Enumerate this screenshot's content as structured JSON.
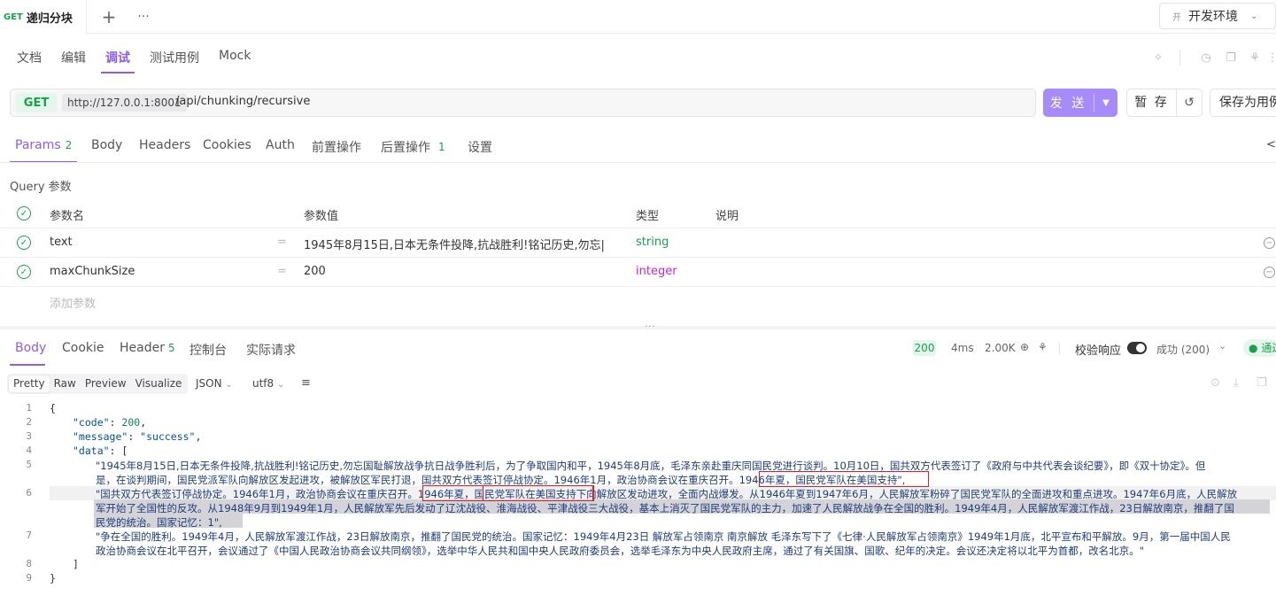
{
  "top": {
    "method": "GET",
    "title": "递归分块",
    "env_badge": "开",
    "env_name": "开发环境"
  },
  "view_tabs": [
    "文档",
    "编辑",
    "调试",
    "测试用例",
    "Mock"
  ],
  "request": {
    "method": "GET",
    "host": "http://127.0.0.1:8001",
    "path": "/api/chunking/recursive",
    "send_label": "发 送",
    "save_label": "暂 存",
    "save_as_label": "保存为用例"
  },
  "param_tabs": [
    {
      "label": "Params",
      "count": "2"
    },
    {
      "label": "Body",
      "count": ""
    },
    {
      "label": "Headers",
      "count": ""
    },
    {
      "label": "Cookies",
      "count": ""
    },
    {
      "label": "Auth",
      "count": ""
    },
    {
      "label": "前置操作",
      "count": ""
    },
    {
      "label": "后置操作",
      "count": "1"
    },
    {
      "label": "设置",
      "count": ""
    }
  ],
  "query": {
    "title": "Query 参数",
    "headers": {
      "name": "参数名",
      "value": "参数值",
      "type": "类型",
      "desc": "说明"
    },
    "rows": [
      {
        "name": "text",
        "value": "1945年8月15日,日本无条件投降,抗战胜利!铭记历史,勿忘|",
        "type": "string"
      },
      {
        "name": "maxChunkSize",
        "value": "200",
        "type": "integer"
      }
    ],
    "add_placeholder": "添加参数"
  },
  "response_tabs": [
    {
      "label": "Body",
      "count": ""
    },
    {
      "label": "Cookie",
      "count": ""
    },
    {
      "label": "Header",
      "count": "5"
    },
    {
      "label": "控制台",
      "count": ""
    },
    {
      "label": "实际请求",
      "count": ""
    }
  ],
  "response_meta": {
    "status": "200",
    "time": "4ms",
    "size": "2.00K",
    "validate_label": "校验响应",
    "result": "成功 (200)",
    "pass": "通过"
  },
  "format": {
    "buttons": [
      "Pretty",
      "Raw",
      "Preview",
      "Visualize"
    ],
    "lang": "JSON",
    "encoding": "utf8"
  },
  "code": {
    "line_numbers": [
      "1",
      "2",
      "3",
      "4",
      "5",
      "",
      "6",
      "",
      "",
      "7",
      "",
      "8",
      "9"
    ],
    "open_brace": "{",
    "code_key": "\"code\"",
    "code_val": "200",
    "message_key": "\"message\"",
    "message_val": "\"success\"",
    "data_key": "\"data\"",
    "item1_l1": "\"1945年8月15日,日本无条件投降,抗战胜利!铭记历史,勿忘国耻解放战争抗日战争胜利后，为了争取国内和平，1945年8月底，毛泽东亲赴重庆同国民党进行谈判。10月10日，国共双方代表签订了《政府与中共代表会谈纪要》，即《双十协定》。但",
    "item1_l2a": "是，在谈判期间，国民党派军队向解放区发起进攻，被解放区军民打退，国共双方代表签订停战协定。1946年1月，政治协商会议在重庆召开。",
    "item1_box": "1946年夏，国民党军队在美国支持",
    "item1_end": "\",",
    "item2_a": "\"国共双方代表签订停战协定。1946年1月，政治协商会议在重庆召开。",
    "item2_box": "1946年夏，国民党军队在美国支持",
    "item2_b": "下向解放区发动进攻，全面内战爆发。从1946年夏到1947年6月，人民解放军粉碎了国民党军队的全面进攻和重点进攻。1947年6月底，人民解放",
    "item2_l2": "军开始了全国性的反攻。从1948年9月到1949年1月，人民解放军先后发动了辽沈战役、淮海战役、平津战役三大战役，基本上消灭了国民党军队的主力，加速了人民解放战争在全国的胜利。1949年4月，人民解放军渡江作战，23日解放南京，推翻了国",
    "item2_l3": "民党的统治。国家记忆：1\",",
    "item3_l1": "\"争在全国的胜利。1949年4月，人民解放军渡江作战，23日解放南京，推翻了国民党的统治。国家记忆：1949年4月23日  解放军占领南京  南京解放  毛泽东写下了《七律·人民解放军占领南京》1949年1月底，北平宣布和平解放。9月，第一届中国人民",
    "item3_l2": "政治协商会议在北平召开，会议通过了《中国人民政治协商会议共同纲领》，选举中华人民共和国中央人民政府委员会，选举毛泽东为中央人民政府主席，通过了有关国旗、国歌、纪年的决定。会议还决定将以北平为首都，改名北京。\"",
    "close_bracket": "]",
    "close_brace": "}"
  }
}
